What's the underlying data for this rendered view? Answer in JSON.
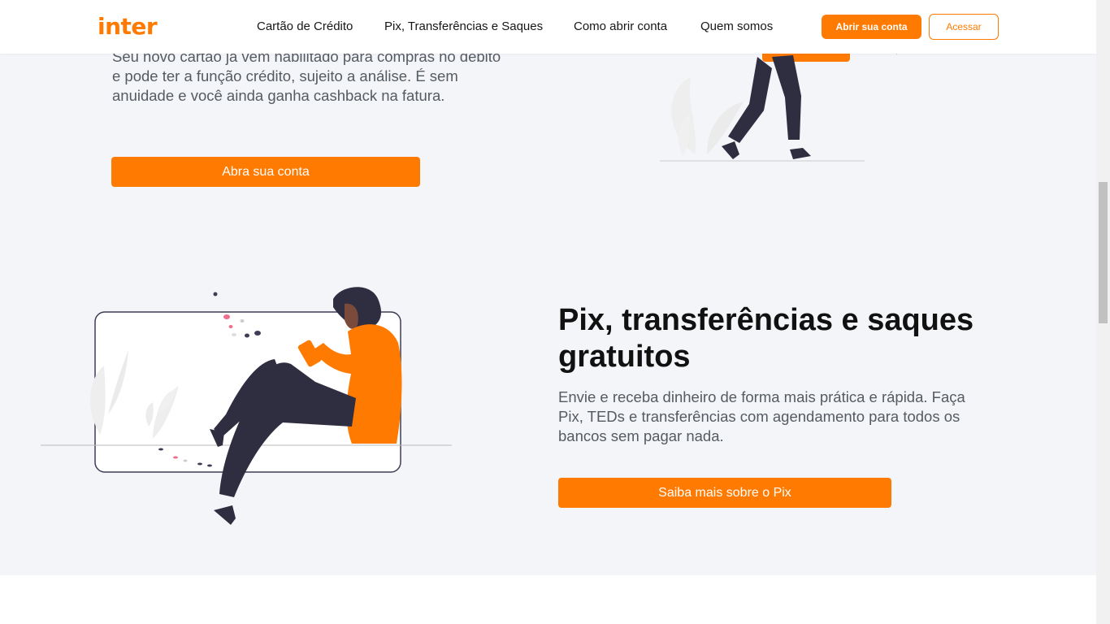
{
  "header": {
    "logo": "inter",
    "nav": [
      {
        "label": "Cartão de Crédito"
      },
      {
        "label": "Pix, Transferências e Saques"
      },
      {
        "label": "Como abrir conta"
      },
      {
        "label": "Quem somos"
      }
    ],
    "open_account_label": "Abrir sua conta",
    "login_label": "Acessar"
  },
  "section_card": {
    "text": "Seu novo cartão já vem habilitado para compras no débito e pode ter a função crédito, sujeito a análise. É sem anuidade e você ainda ganha cashback na fatura.",
    "button_label": "Abra sua conta"
  },
  "section_pix": {
    "title": "Pix, transferências e saques gratuitos",
    "text": "Envie e receba dinheiro de forma mais prática e rápida. Faça Pix, TEDs e transferências com agendamento para todos os bancos sem pagar nada.",
    "button_label": "Saiba mais sobre o Pix"
  },
  "colors": {
    "accent": "#ff7a00",
    "section_bg": "#f4f5f8",
    "heading": "#111111",
    "body_text": "#555b62"
  }
}
